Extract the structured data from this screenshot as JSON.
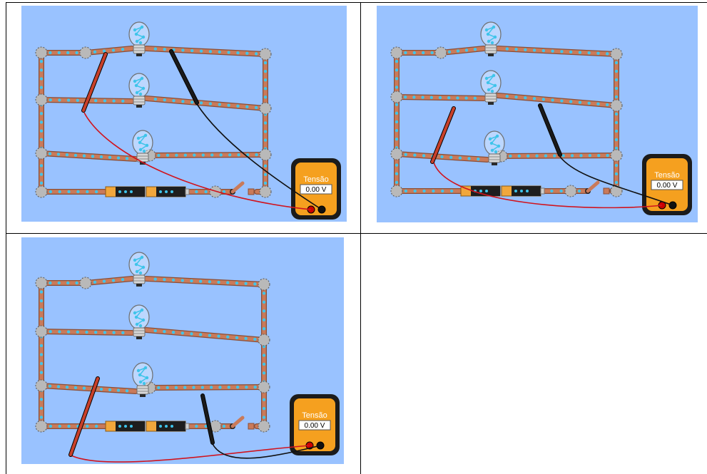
{
  "panels": [
    {
      "id": "panel-1",
      "meter": {
        "label": "Tensão",
        "reading": "0.00 V"
      }
    },
    {
      "id": "panel-2",
      "meter": {
        "label": "Tensão",
        "reading": "0.00 V"
      }
    },
    {
      "id": "panel-3",
      "meter": {
        "label": "Tensão",
        "reading": "0.00 V"
      }
    }
  ],
  "colors": {
    "background": "#99c2ff",
    "wire": "#c97a5a",
    "electron": "#3fc4ea",
    "meter_body": "#f5a01f",
    "meter_case": "#1b1b1b",
    "red_probe": "#c9402a",
    "black_probe": "#1a1a1a"
  },
  "icons": [
    "bulb-icon",
    "battery-icon",
    "switch-icon",
    "voltmeter-icon",
    "probe-icon"
  ]
}
